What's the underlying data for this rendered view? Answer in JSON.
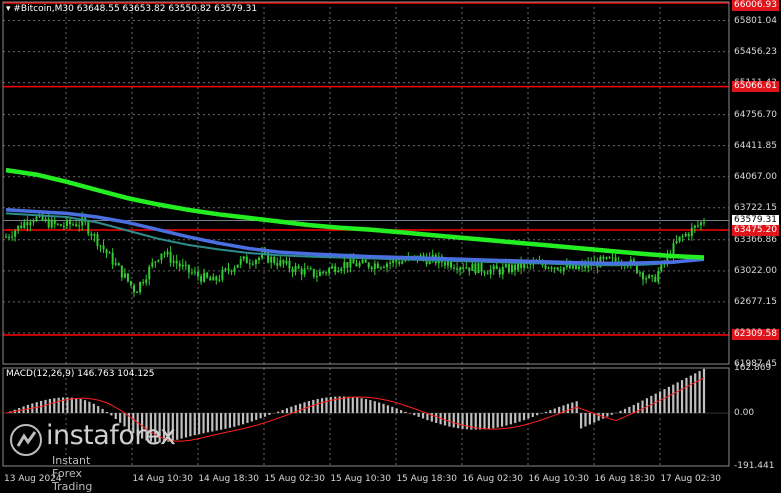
{
  "header": {
    "title": "▾ #Bitcoin,M30  63648.55 63653.82 63550.82 63579.31"
  },
  "price_axis": {
    "ticks": [
      "65801.04",
      "65456.23",
      "65111.42",
      "64756.70",
      "64411.85",
      "64067.00",
      "63722.15",
      "63366.86",
      "63022.00",
      "62677.15",
      "62332.30",
      "61987.45"
    ],
    "levels": [
      {
        "label": "66006.93",
        "style": "red"
      },
      {
        "label": "65066.61",
        "style": "red"
      },
      {
        "label": "63579.31",
        "style": "white"
      },
      {
        "label": "63475.20",
        "style": "red"
      },
      {
        "label": "62309.58",
        "style": "red"
      }
    ]
  },
  "time_axis": {
    "ticks": [
      "13 Aug 2024",
      "14 Aug 10:30",
      "14 Aug 18:30",
      "15 Aug 02:30",
      "15 Aug 10:30",
      "15 Aug 18:30",
      "16 Aug 02:30",
      "16 Aug 10:30",
      "16 Aug 18:30",
      "17 Aug 02:30"
    ]
  },
  "macd": {
    "title": "MACD(12,26,9) 146.763 104.125",
    "ticks": [
      "162.869",
      "0.00",
      "-191.441"
    ]
  },
  "watermark": {
    "brand": "instaforex",
    "tagline": "Instant Forex Trading"
  },
  "colors": {
    "background": "#000000",
    "grid": "#6b6b6b",
    "candles": "#33cc33",
    "ma_slow": "#22ee22",
    "ma_mid": "#4a6fe0",
    "ma_fast": "#2e8b8b",
    "level": "#ff0000",
    "macd_hist": "#c0c0c0",
    "macd_signal": "#ff2020"
  },
  "chart_data": {
    "type": "line",
    "x_range": [
      "13 Aug 2024",
      "17 Aug 02:30"
    ],
    "ylim": [
      61987.45,
      66006.93
    ],
    "series": [
      {
        "values": [
          64140,
          64090,
          64010,
          63920,
          63830,
          63760,
          63700,
          63650,
          63610,
          63570,
          63530,
          63500,
          63480,
          63450,
          63420,
          63390,
          63360,
          63330,
          63300,
          63270,
          63240,
          63210,
          63185,
          63170
        ]
      },
      {
        "values": [
          63700,
          63680,
          63660,
          63620,
          63560,
          63480,
          63400,
          63330,
          63270,
          63230,
          63210,
          63195,
          63180,
          63170,
          63160,
          63150,
          63140,
          63130,
          63120,
          63110,
          63105,
          63110,
          63120,
          63150
        ]
      },
      {
        "values": [
          63660,
          63640,
          63620,
          63560,
          63470,
          63380,
          63310,
          63260,
          63220,
          63195,
          63180,
          63170,
          63160,
          63150,
          63140,
          63130,
          63120,
          63110,
          63100,
          63090,
          63085,
          63090,
          63110,
          63150
        ]
      }
    ],
    "price_points": [
      63400,
      63620,
      63520,
      63560,
      63180,
      62800,
      63240,
      63020,
      62900,
      63120,
      63180,
      63060,
      62980,
      63100,
      63090,
      63120,
      63170,
      63120,
      63060,
      63020,
      63080,
      63090,
      63040,
      63120,
      63140,
      62900,
      63360,
      63579
    ]
  }
}
